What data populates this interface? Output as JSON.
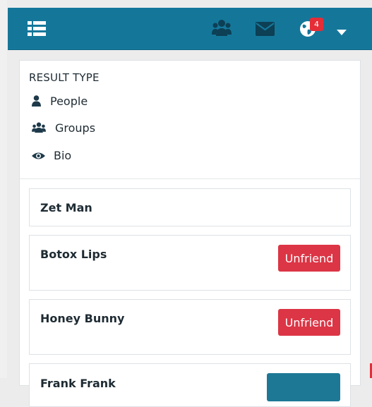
{
  "header": {
    "notification_count": "4",
    "icons": [
      "menu-icon",
      "people-icon",
      "mail-icon",
      "globe-icon",
      "caret-down-icon"
    ],
    "color": "#14779a"
  },
  "filters": {
    "title": "RESULT TYPE",
    "items": [
      {
        "icon": "user-icon",
        "label": "People"
      },
      {
        "icon": "people-icon",
        "label": "Groups"
      },
      {
        "icon": "eye-icon",
        "label": "Bio"
      }
    ]
  },
  "results": [
    {
      "name": "Zet Man",
      "action": ""
    },
    {
      "name": "Botox Lips",
      "action": "Unfriend"
    },
    {
      "name": "Honey Bunny",
      "action": "Unfriend"
    },
    {
      "name": "Frank Frank",
      "action": ""
    }
  ],
  "colors": {
    "unfriend": "#dc3545",
    "badge": "#e52d37",
    "text": "#1e2b33"
  }
}
